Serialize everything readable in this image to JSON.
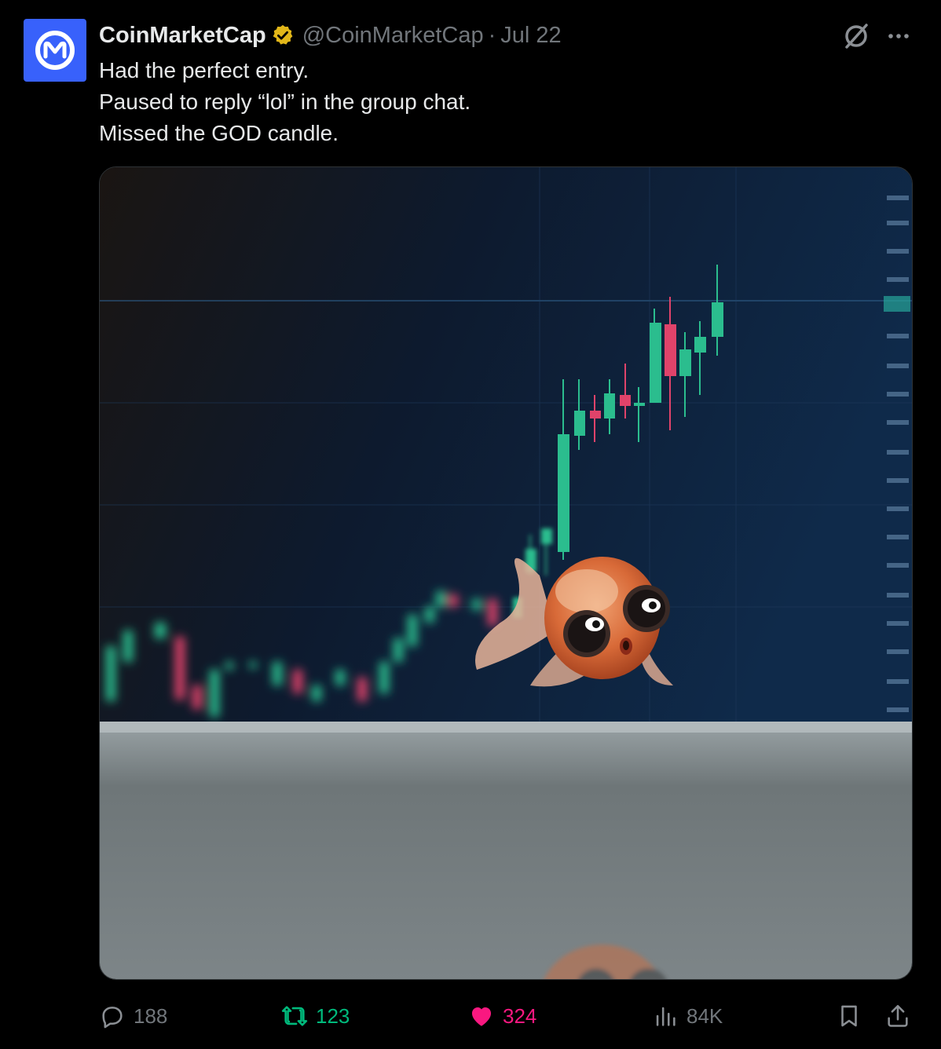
{
  "author": {
    "display_name": "CoinMarketCap",
    "handle": "@CoinMarketCap",
    "separator": "·",
    "date": "Jul 22",
    "verified": true,
    "verified_color": "#e2b719",
    "avatar_color": "#3861fb",
    "avatar_icon": "coinmarketcap-logo-icon"
  },
  "tweet": {
    "lines": [
      "Had the perfect entry.",
      "Paused to reply “lol” in the group chat.",
      "Missed the GOD candle."
    ]
  },
  "media": {
    "kind": "meme-image",
    "subject": "goldfish-with-candlestick-chart",
    "icon": "image"
  },
  "actions": {
    "reply": {
      "icon": "reply-icon",
      "count": "188"
    },
    "repost": {
      "icon": "repost-icon",
      "count": "123",
      "color": "#00ba7c"
    },
    "like": {
      "icon": "heart-icon",
      "count": "324",
      "color": "#f91880"
    },
    "views": {
      "icon": "views-icon",
      "count": "84K"
    },
    "bookmark": {
      "icon": "bookmark-icon"
    },
    "share": {
      "icon": "share-icon"
    }
  },
  "toolbar": {
    "grok_icon": "grok-icon",
    "more_icon": "more-icon"
  }
}
